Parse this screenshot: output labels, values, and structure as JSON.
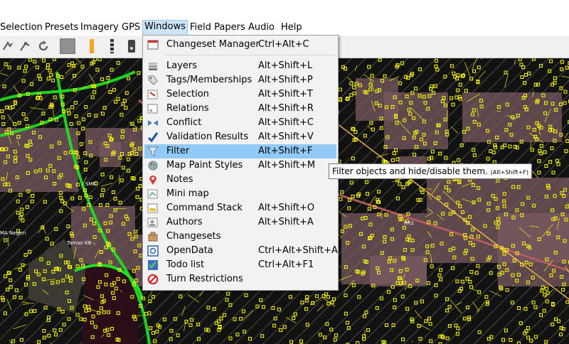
{
  "menubar": {
    "items": [
      "Selection",
      "Presets",
      "Imagery",
      "GPS",
      "Windows",
      "Field Papers",
      "Audio",
      "Help"
    ],
    "active": "Windows"
  },
  "toolbar": {
    "icons": [
      "select-tool-icon",
      "draw-tool-icon",
      "refresh-icon",
      "gray-square-icon",
      "orange-divider-icon",
      "black-divider-icon",
      "phone-icon"
    ]
  },
  "windows_menu": {
    "items": [
      {
        "label": "Changeset Manager",
        "shortcut": "Ctrl+Alt+C",
        "icon": "changeset-manager-icon"
      },
      {
        "label": "Layers",
        "shortcut": "Alt+Shift+L",
        "icon": "layers-icon"
      },
      {
        "label": "Tags/Memberships",
        "shortcut": "Alt+Shift+P",
        "icon": "tag-icon"
      },
      {
        "label": "Selection",
        "shortcut": "Alt+Shift+T",
        "icon": "selection-icon"
      },
      {
        "label": "Relations",
        "shortcut": "Alt+Shift+R",
        "icon": "relations-icon"
      },
      {
        "label": "Conflict",
        "shortcut": "Alt+Shift+C",
        "icon": "conflict-icon"
      },
      {
        "label": "Validation Results",
        "shortcut": "Alt+Shift+V",
        "icon": "checkmark-icon"
      },
      {
        "label": "Filter",
        "shortcut": "Alt+Shift+F",
        "icon": "filter-funnel-icon"
      },
      {
        "label": "Map Paint Styles",
        "shortcut": "Alt+Shift+M",
        "icon": "paint-styles-icon"
      },
      {
        "label": "Notes",
        "shortcut": "",
        "icon": "map-pin-icon"
      },
      {
        "label": "Mini map",
        "shortcut": "",
        "icon": "mini-map-icon"
      },
      {
        "label": "Command Stack",
        "shortcut": "Alt+Shift+O",
        "icon": "command-stack-icon"
      },
      {
        "label": "Authors",
        "shortcut": "Alt+Shift+A",
        "icon": "authors-icon"
      },
      {
        "label": "Changesets",
        "shortcut": "",
        "icon": "changesets-icon"
      },
      {
        "label": "OpenData",
        "shortcut": "Ctrl+Alt+Shift+A",
        "icon": "opendata-icon"
      },
      {
        "label": "Todo list",
        "shortcut": "Ctrl+Alt+F1",
        "icon": "todo-list-icon"
      },
      {
        "label": "Turn Restrictions",
        "shortcut": "",
        "icon": "no-turn-icon"
      }
    ],
    "hovered": "Filter"
  },
  "tooltip": {
    "text": "Filter objects and hide/disable them.",
    "shortcut": "(Alt+Shift+F)"
  },
  "map": {
    "labels": [
      "SMK",
      "Taman KB",
      "MA Negeri",
      "RR1"
    ],
    "colors": {
      "node": "#ffff00",
      "road": "#22dd22",
      "building": "#7a5a63",
      "background": "#111111"
    }
  }
}
